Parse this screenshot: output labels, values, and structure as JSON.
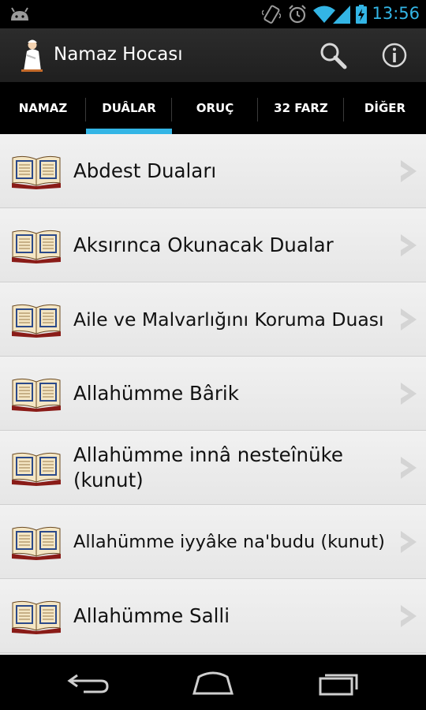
{
  "status_bar": {
    "time": "13:56",
    "icons": [
      "android-notification-icon",
      "vibrate-icon",
      "alarm-icon",
      "wifi-icon",
      "signal-icon",
      "battery-charging-icon"
    ]
  },
  "action_bar": {
    "title": "Namaz Hocası",
    "icons": [
      "app-logo-icon",
      "search-icon",
      "info-icon"
    ]
  },
  "tabs": [
    {
      "label": "NAMAZ",
      "selected": false
    },
    {
      "label": "DUÂLAR",
      "selected": true
    },
    {
      "label": "ORUÇ",
      "selected": false
    },
    {
      "label": "32 FARZ",
      "selected": false
    },
    {
      "label": "DİĞER",
      "selected": false
    }
  ],
  "list": {
    "items": [
      {
        "label": "Abdest Duaları",
        "icon": "book-icon"
      },
      {
        "label": "Aksırınca Okunacak Dualar",
        "icon": "book-icon"
      },
      {
        "label": "Aile ve Malvarlığını Koruma Duası",
        "icon": "book-icon"
      },
      {
        "label": "Allahümme Bârik",
        "icon": "book-icon"
      },
      {
        "label": "Allahümme innâ nesteînüke (kunut)",
        "icon": "book-icon"
      },
      {
        "label": "Allahümme iyyâke na'budu (kunut)",
        "icon": "book-icon"
      },
      {
        "label": "Allahümme Salli",
        "icon": "book-icon"
      }
    ]
  },
  "nav_bar": {
    "icons": [
      "back-icon",
      "home-icon",
      "recent-apps-icon"
    ]
  },
  "colors": {
    "accent": "#33b5e5",
    "bar_background": "#000000",
    "action_bar": "#262626",
    "list_background": "#ebebeb"
  }
}
